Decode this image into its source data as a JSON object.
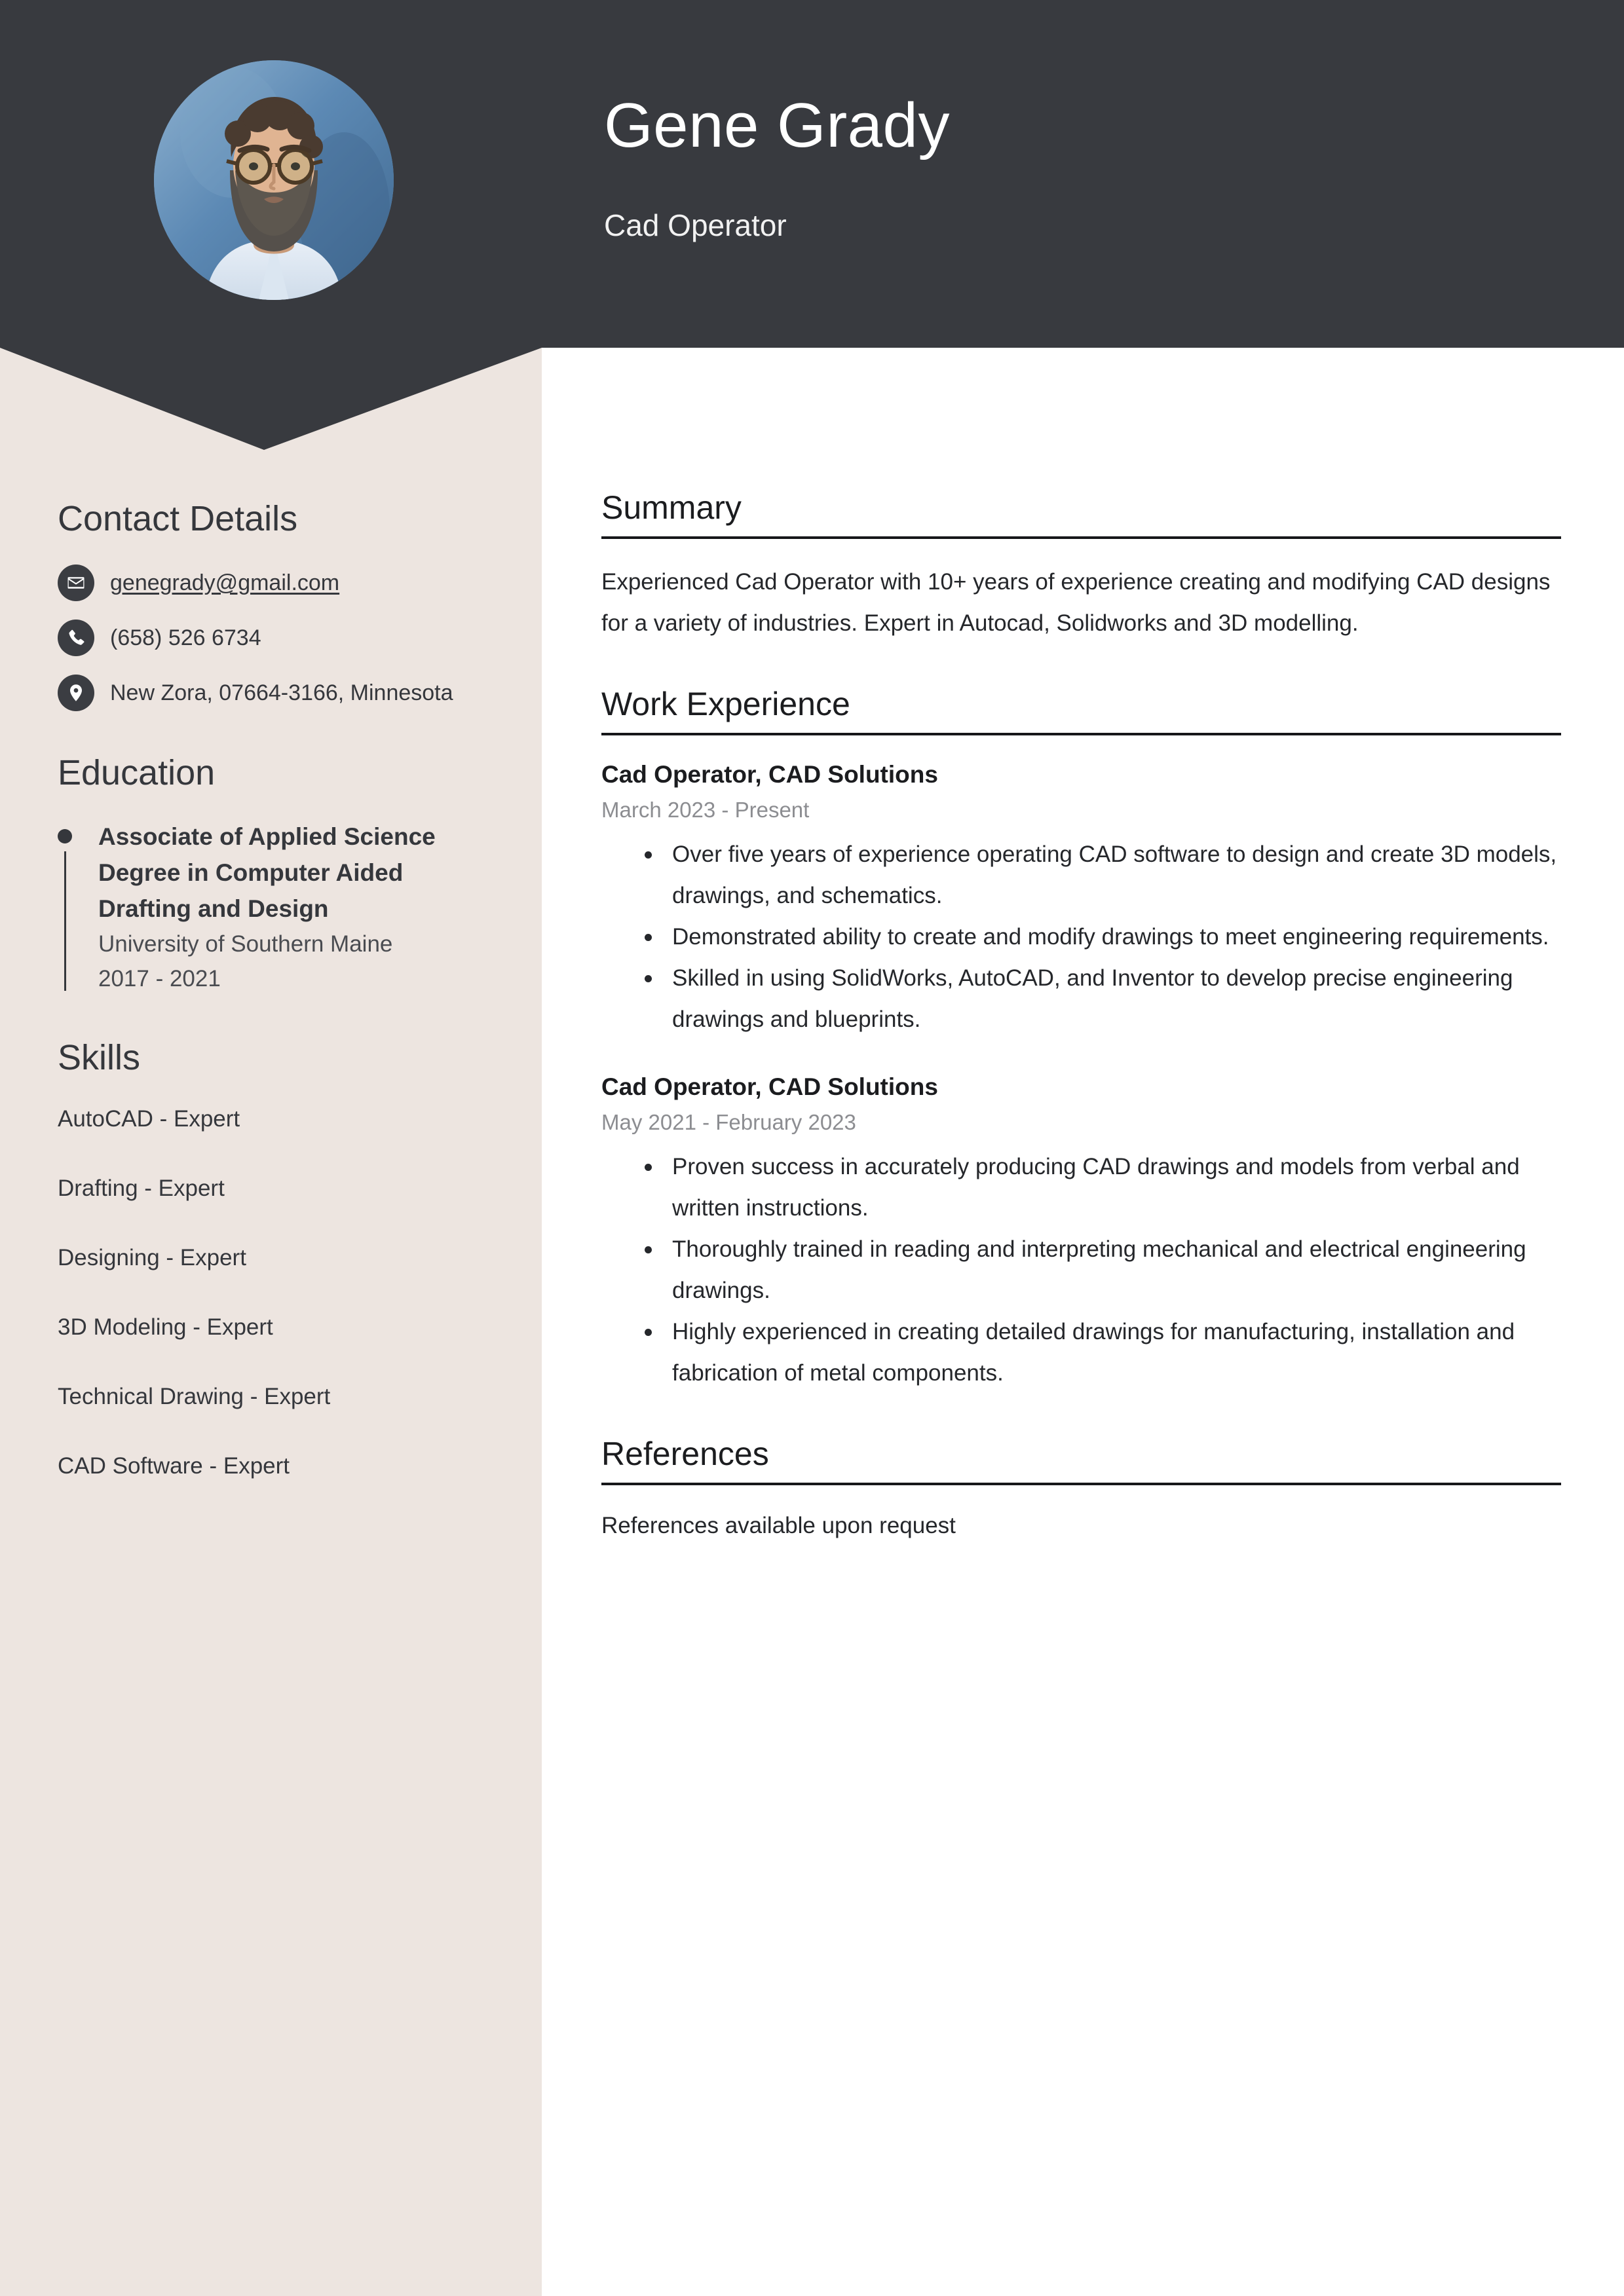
{
  "theme": {
    "header_bg": "#383A3F",
    "sidebar_bg": "#EDE5E0",
    "main_bg": "#FFFFFF",
    "text": "#35373C",
    "muted_text": "#8C8D91",
    "rule": "#16171A"
  },
  "header": {
    "name": "Gene Grady",
    "role": "Cad Operator",
    "avatar_alt": "profile-photo"
  },
  "sidebar": {
    "contact": {
      "heading": "Contact Details",
      "items": [
        {
          "icon": "envelope-icon",
          "value": "genegrady@gmail.com",
          "is_link": true
        },
        {
          "icon": "phone-icon",
          "value": "(658) 526 6734",
          "is_link": false
        },
        {
          "icon": "location-pin-icon",
          "value": "New Zora, 07664-3166, Minnesota",
          "is_link": false
        }
      ]
    },
    "education": {
      "heading": "Education",
      "items": [
        {
          "degree": "Associate of Applied Science Degree in Computer Aided Drafting and Design",
          "school": "University of Southern Maine",
          "dates": "2017 - 2021"
        }
      ]
    },
    "skills": {
      "heading": "Skills",
      "items": [
        "AutoCAD - Expert",
        "Drafting - Expert",
        "Designing - Expert",
        "3D Modeling - Expert",
        "Technical Drawing - Expert",
        "CAD Software - Expert"
      ]
    }
  },
  "main": {
    "summary": {
      "heading": "Summary",
      "text": "Experienced Cad Operator with 10+ years of experience creating and modifying CAD designs for a variety of industries. Expert in Autocad, Solidworks and 3D modelling."
    },
    "work_experience": {
      "heading": "Work Experience",
      "jobs": [
        {
          "title": "Cad Operator, CAD Solutions",
          "dates": "March 2023 - Present",
          "bullets": [
            "Over five years of experience operating CAD software to design and create 3D models, drawings, and schematics.",
            "Demonstrated ability to create and modify drawings to meet engineering requirements.",
            "Skilled in using SolidWorks, AutoCAD, and Inventor to develop precise engineering drawings and blueprints."
          ]
        },
        {
          "title": "Cad Operator, CAD Solutions",
          "dates": "May 2021 - February 2023",
          "bullets": [
            "Proven success in accurately producing CAD drawings and models from verbal and written instructions.",
            "Thoroughly trained in reading and interpreting mechanical and electrical engineering drawings.",
            "Highly experienced in creating detailed drawings for manufacturing, installation and fabrication of metal components."
          ]
        }
      ]
    },
    "references": {
      "heading": "References",
      "text": "References available upon request"
    }
  }
}
